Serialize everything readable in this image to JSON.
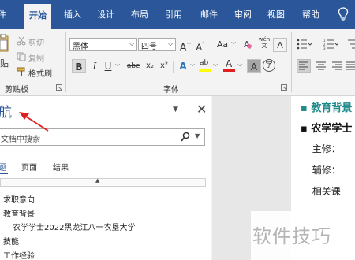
{
  "ribbon_tabs": {
    "file": "件",
    "home": "开始",
    "insert": "插入",
    "design": "设计",
    "layout": "布局",
    "references": "引用",
    "mailings": "邮件",
    "review": "审阅",
    "view": "视图",
    "help": "帮助"
  },
  "clipboard": {
    "cut": "剪切",
    "copy": "复制",
    "paste": "贴",
    "format_painter": "格式刷",
    "group_label": "剪贴板"
  },
  "font": {
    "font_name": "黑体",
    "font_size": "四号",
    "change_case": "Aa",
    "phonetic": "wén",
    "border_char": "A",
    "bold": "B",
    "italic": "I",
    "underline": "U",
    "strikethrough": "abc",
    "subscript": "x₂",
    "superscript": "x²",
    "effects": "A",
    "highlight": "ab",
    "font_color": "A",
    "shading": "A",
    "enclose": "字",
    "group_label": "字体"
  },
  "navigation": {
    "title": "航",
    "search_placeholder": "文档中搜索",
    "tabs": [
      "题",
      "页面",
      "结果"
    ],
    "headings": [
      {
        "text": "求职意向",
        "level": 1
      },
      {
        "text": "教育背景",
        "level": 1
      },
      {
        "text": "农学学士2022黑龙江八一农垦大学",
        "level": 2
      },
      {
        "text": "技能",
        "level": 1
      },
      {
        "text": "工作经验",
        "level": 1
      }
    ]
  },
  "document": {
    "heading": "教育背景",
    "degree_line": "农学学士",
    "items": [
      "主修：",
      "辅修：",
      "相关课"
    ]
  },
  "watermark": "软件技巧",
  "colors": {
    "ribbon_blue": "#2b579a",
    "heading_teal": "#1f8a8a",
    "arrow_red": "#e02020"
  }
}
